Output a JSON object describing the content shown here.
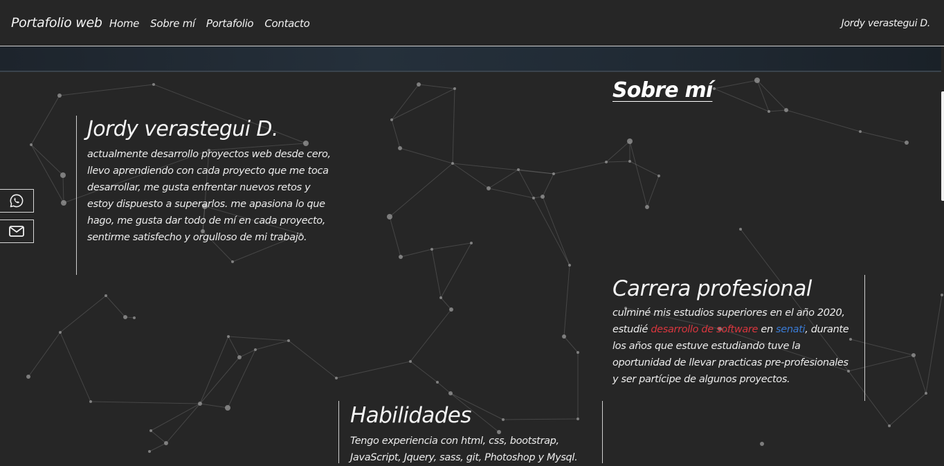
{
  "nav": {
    "brand": "Portafolio web",
    "links": [
      "Home",
      "Sobre mí",
      "Portafolio",
      "Contacto"
    ],
    "user": "Jordy verastegui D."
  },
  "social": {
    "items": [
      {
        "name": "whatsapp-icon"
      },
      {
        "name": "mail-icon"
      }
    ]
  },
  "about": {
    "name": "Jordy verastegui D.",
    "paragraph": "actualmente desarrollo proyectos web desde cero, llevo aprendiendo con cada proyecto que me toca desarrollar, me gusta enfrentar nuevos retos y estoy dispuesto a superarlos. me apasiona lo que hago, me gusta dar todo de mí en cada proyecto, sentirme satisfecho y orgulloso de mi trabajo."
  },
  "sobre": {
    "title": "Sobre mí"
  },
  "career": {
    "title": "Carrera profesional",
    "text_1": "culminé mis estudios superiores en el año 2020, estudié ",
    "highlight_red": "desarrollo de software",
    "text_2": " en ",
    "highlight_blue": "senati",
    "text_3": ", durante los años que estuve estudiando tuve la oportunidad de llevar practicas pre-profesionales y ser partícipe de algunos proyectos."
  },
  "skills": {
    "title": "Habilidades",
    "text": "Tengo experiencia con html, css, bootstrap, JavaScript, Jquery, sass, git, Photoshop y Mysql."
  },
  "colors": {
    "background": "#262626",
    "accent_red": "#d9363e",
    "accent_blue": "#3a7bd5",
    "network": "#9a9a9a"
  }
}
